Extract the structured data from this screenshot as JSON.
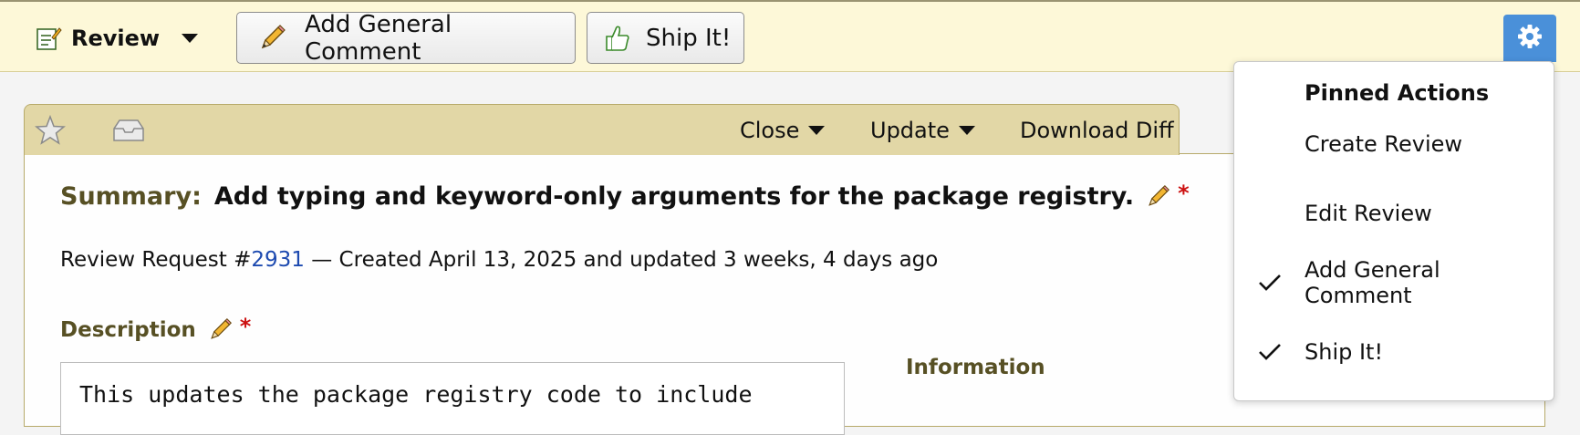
{
  "topbar": {
    "review_label": "Review",
    "add_general_comment_label": "Add General Comment",
    "ship_it_label": "Ship It!"
  },
  "request_tabs": {
    "close_label": "Close",
    "update_label": "Update",
    "download_diff_label": "Download Diff"
  },
  "summary": {
    "label": "Summary:",
    "text": "Add typing and keyword-only arguments for the package registry.",
    "required_mark": "*"
  },
  "meta": {
    "prefix": "Review Request #",
    "request_id": "2931",
    "suffix": " — Created April 13, 2025 and updated 3 weeks, 4 days ago"
  },
  "description": {
    "label": "Description",
    "required_mark": "*",
    "text": "This updates the package registry code to include"
  },
  "information": {
    "label": "Information"
  },
  "dropdown": {
    "header": "Pinned Actions",
    "items": [
      {
        "label": "Create Review",
        "checked": false
      },
      {
        "label": "Edit Review",
        "checked": false
      },
      {
        "label": "Add General Comment",
        "checked": true
      },
      {
        "label": "Ship It!",
        "checked": true
      }
    ]
  },
  "colors": {
    "topbar_bg": "#fdf8d8",
    "tab_bg": "#e2d7a6",
    "heading": "#575024",
    "gear_button": "#4a90d9",
    "link": "#1d4ab0",
    "required": "#cc1111"
  },
  "icons": {
    "review_menu": "review-document-icon",
    "general_comment": "pencil-icon",
    "ship_it": "thumbs-up-icon",
    "settings": "gear-icon",
    "star": "star-icon",
    "inbox": "inbox-icon",
    "check": "checkmark-icon"
  }
}
